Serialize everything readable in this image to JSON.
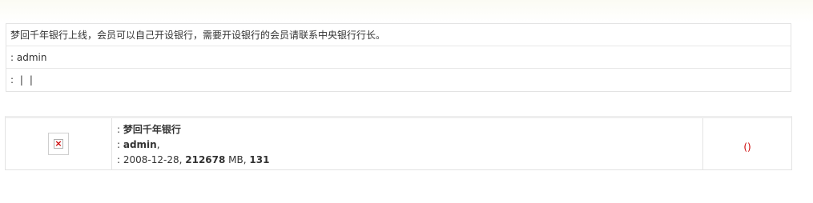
{
  "notice": {
    "text": "梦回千年银行上线，会员可以自己开设银行，需要开设银行的会员请联系中央银行行长。",
    "admin_prefix": ": ",
    "admin_name": "admin",
    "links_prefix": ": ",
    "separators": [
      "|",
      "|"
    ]
  },
  "bank": {
    "logo_icon": "broken-image-icon",
    "name_prefix": ": ",
    "name": "梦回千年银行",
    "owner_prefix": ": ",
    "owner": "admin",
    "owner_suffix": ",",
    "stats_prefix": ": ",
    "date": "2008-12-28",
    "comma1": ", ",
    "size": "212678",
    "size_unit": " MB, ",
    "count": "131",
    "action": "()"
  }
}
